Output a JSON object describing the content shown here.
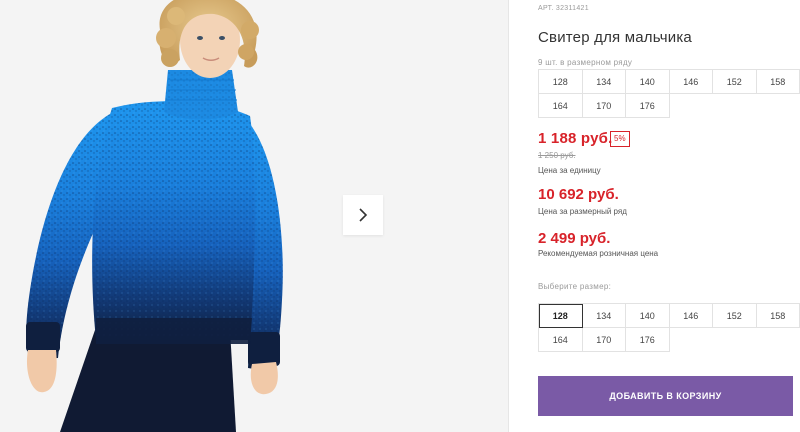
{
  "product": {
    "sku": "АРТ. 32311421",
    "title": "Свитер для мальчика",
    "range_note": "9 шт. в размерном ряду",
    "range_sizes": [
      "128",
      "134",
      "140",
      "146",
      "152",
      "158",
      "164",
      "170",
      "176"
    ],
    "price": "1 188 руб.",
    "discount": "5%",
    "old_price": "1 250 руб.",
    "price_unit_label": "Цена за единицу",
    "price_range": "10 692 руб.",
    "price_range_label": "Цена за размерный ряд",
    "price_rrp": "2 499 руб.",
    "price_rrp_label": "Рекомендуемая розничная цена",
    "choose_size_label": "Выберите размер:",
    "sizes": [
      "128",
      "134",
      "140",
      "146",
      "152",
      "158",
      "164",
      "170",
      "176"
    ],
    "selected_size": "128",
    "add_to_cart": "ДОБАВИТЬ В КОРЗИНУ"
  },
  "gallery": {
    "next_icon": "chevron-right-icon"
  },
  "colors": {
    "price": "#d8232a",
    "button": "#7a5aa6",
    "sweater_top": "#1d8fe6",
    "sweater_bottom": "#10203d"
  }
}
